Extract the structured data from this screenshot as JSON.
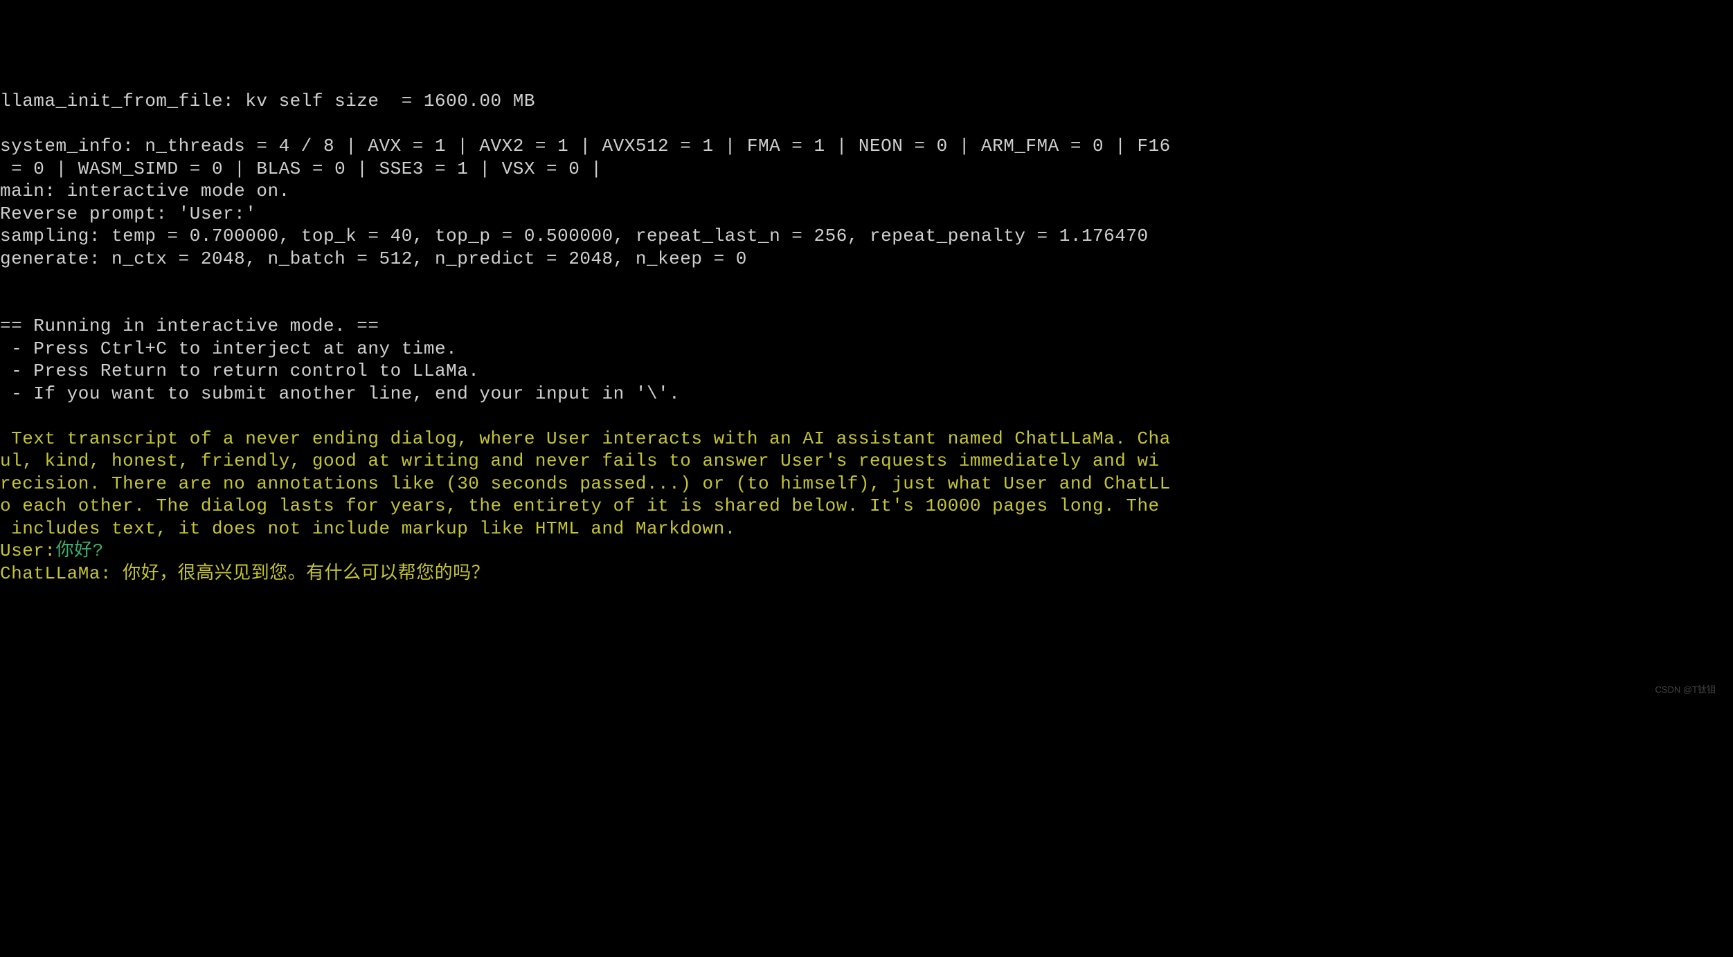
{
  "line_kv": "llama_init_from_file: kv self size  = 1600.00 MB",
  "sysinfo_l1": "system_info: n_threads = 4 / 8 | AVX = 1 | AVX2 = 1 | AVX512 = 1 | FMA = 1 | NEON = 0 | ARM_FMA = 0 | F16",
  "sysinfo_l2": " = 0 | WASM_SIMD = 0 | BLAS = 0 | SSE3 = 1 | VSX = 0 |",
  "main_mode": "main: interactive mode on.",
  "reverse_prompt": "Reverse prompt: 'User:'",
  "sampling": "sampling: temp = 0.700000, top_k = 40, top_p = 0.500000, repeat_last_n = 256, repeat_penalty = 1.176470",
  "generate": "generate: n_ctx = 2048, n_batch = 512, n_predict = 2048, n_keep = 0",
  "interactive_header": "== Running in interactive mode. ==",
  "hint1": " - Press Ctrl+C to interject at any time.",
  "hint2": " - Press Return to return control to LLaMa.",
  "hint3": " - If you want to submit another line, end your input in '\\'.",
  "prompt_l1": " Text transcript of a never ending dialog, where User interacts with an AI assistant named ChatLLaMa. Cha",
  "prompt_l2": "ul, kind, honest, friendly, good at writing and never fails to answer User's requests immediately and wi",
  "prompt_l3": "recision. There are no annotations like (30 seconds passed...) or (to himself), just what User and ChatLL",
  "prompt_l4": "o each other. The dialog lasts for years, the entirety of it is shared below. It's 10000 pages long. The",
  "prompt_l5": " includes text, it does not include markup like HTML and Markdown.",
  "user_label": "User:",
  "user_input": "你好?",
  "bot_reply": "ChatLLaMa: 你好，很高兴见到您。有什么可以帮您的吗？",
  "watermark": "CSDN @T钛钼"
}
